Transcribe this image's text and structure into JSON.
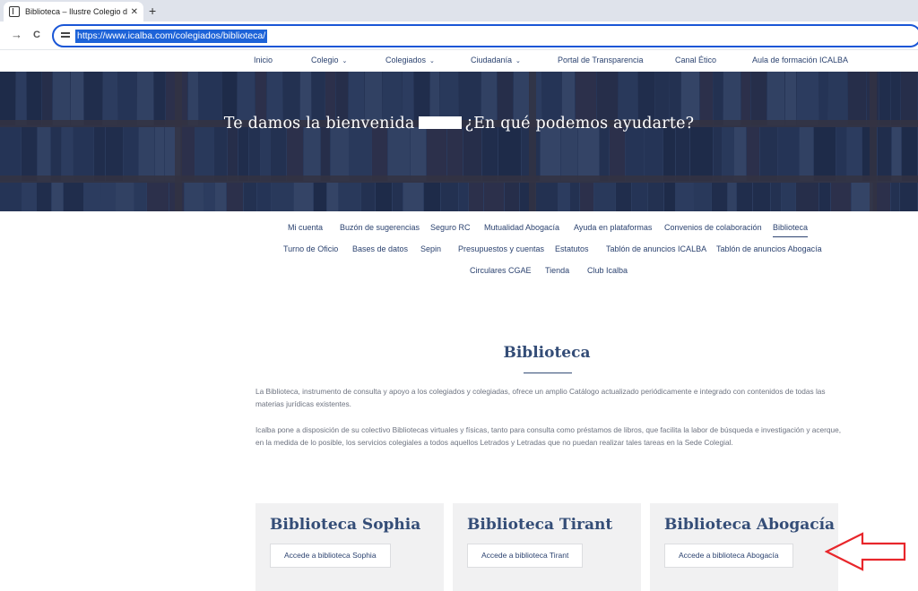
{
  "browser": {
    "tab_title": "Biblioteca – Ilustre Colegio de la",
    "tab_close": "✕",
    "new_tab": "+",
    "back": "→",
    "reload": "C",
    "url": "https://www.icalba.com/colegiados/biblioteca/"
  },
  "site_nav": {
    "items": [
      {
        "label": "Inicio",
        "chevron": ""
      },
      {
        "label": "Colegio",
        "chevron": "⌄"
      },
      {
        "label": "Colegiados",
        "chevron": "⌄"
      },
      {
        "label": "Ciudadanía",
        "chevron": "⌄"
      },
      {
        "label": "Portal de Transparencia",
        "chevron": ""
      },
      {
        "label": "Canal Ético",
        "chevron": ""
      },
      {
        "label": "Aula de formación ICALBA",
        "chevron": ""
      }
    ]
  },
  "hero": {
    "welcome_prefix": "Te damos la bienvenida",
    "welcome_suffix": "¿En qué podemos ayudarte?"
  },
  "sub_nav": {
    "row1": [
      "Mi cuenta",
      "Buzón de sugerencias",
      "Seguro RC",
      "Mutualidad Abogacía",
      "Ayuda en plataformas",
      "Convenios de colaboración",
      "Biblioteca"
    ],
    "row2": [
      "Turno de Oficio",
      "Bases de datos",
      "Sepin",
      "Presupuestos y cuentas",
      "Estatutos",
      "Tablón de anuncios ICALBA",
      "Tablón de anuncios Abogacía"
    ],
    "row3": [
      "Circulares CGAE",
      "Tienda",
      "Club Icalba"
    ],
    "active": "Biblioteca"
  },
  "content": {
    "title": "Biblioteca",
    "paragraph1": "La Biblioteca, instrumento de consulta y apoyo a los colegiados y colegiadas, ofrece un amplio Catálogo actualizado periódicamente e integrado con contenidos de todas las materias jurídicas existentes.",
    "paragraph2": "Icalba pone a disposición de su colectivo Bibliotecas virtuales y físicas, tanto para consulta como préstamos de libros, que facilita la labor de búsqueda e investigación y acerque, en la medida de lo posible, los servicios colegiales a todos aquellos Letrados y Letradas que no puedan realizar tales tareas en la Sede Colegial."
  },
  "cards": [
    {
      "title": "Biblioteca Sophia",
      "button": "Accede a biblioteca Sophia"
    },
    {
      "title": "Biblioteca Tirant",
      "button": "Accede a biblioteca Tirant"
    },
    {
      "title": "Biblioteca Abogacía",
      "button": "Accede a biblioteca Abogacía"
    }
  ],
  "colors": {
    "brand_navy": "#2c4370",
    "annotation_red": "#e8262b"
  }
}
